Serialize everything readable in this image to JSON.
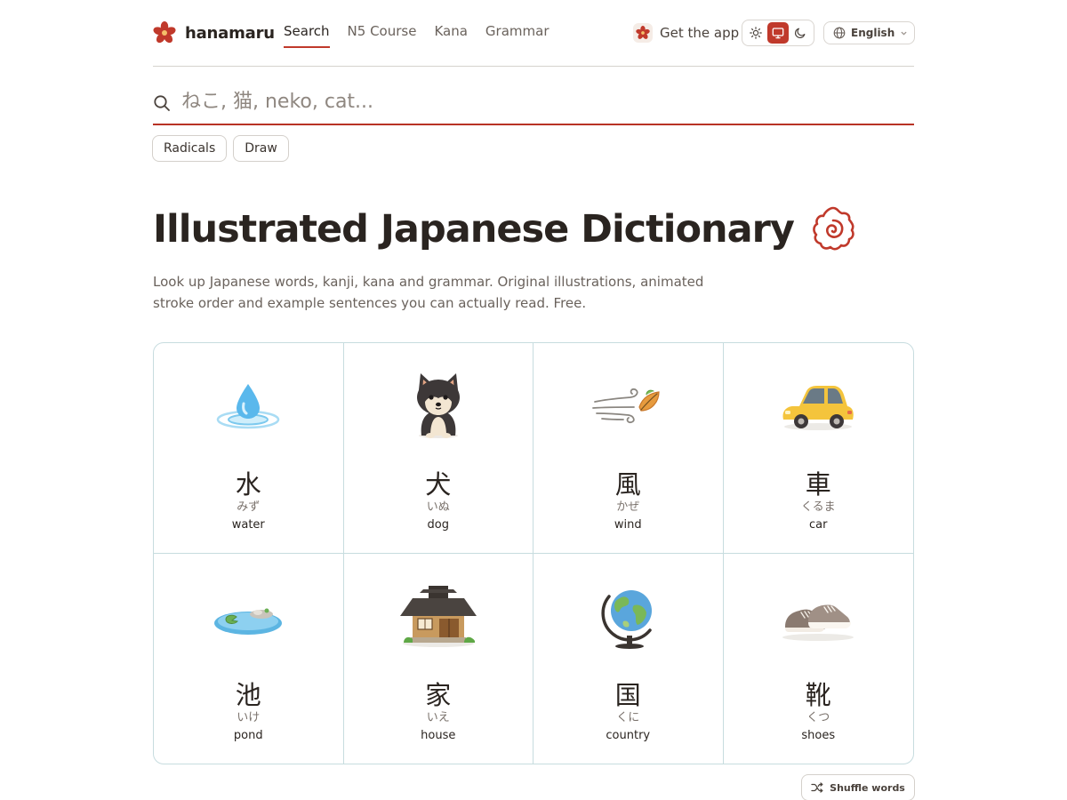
{
  "brand": {
    "name": "hanamaru",
    "logo_icon": "flower-icon",
    "accent": "#c0392b"
  },
  "nav": {
    "items": [
      {
        "label": "Search",
        "active": true
      },
      {
        "label": "N5 Course",
        "active": false
      },
      {
        "label": "Kana",
        "active": false
      },
      {
        "label": "Grammar",
        "active": false
      }
    ]
  },
  "header_actions": {
    "get_app_label": "Get the app",
    "theme_options": [
      "sun-icon",
      "monitor-icon",
      "moon-icon"
    ],
    "theme_selected": "monitor-icon",
    "language_label": "English"
  },
  "search": {
    "placeholder": "ねこ, 猫, neko, cat...",
    "value": "",
    "tools": [
      "Radicals",
      "Draw"
    ]
  },
  "hero": {
    "title": "Illustrated Japanese Dictionary",
    "subtitle": "Look up Japanese words, kanji, kana and grammar. Original illustrations, animated stroke order and example sentences you can actually read. Free."
  },
  "words": [
    {
      "kanji": "水",
      "kana": "みず",
      "gloss": "water",
      "icon": "water-drop-icon"
    },
    {
      "kanji": "犬",
      "kana": "いぬ",
      "gloss": "dog",
      "icon": "shiba-dog-icon"
    },
    {
      "kanji": "風",
      "kana": "かぜ",
      "gloss": "wind",
      "icon": "wind-leaf-icon"
    },
    {
      "kanji": "車",
      "kana": "くるま",
      "gloss": "car",
      "icon": "car-icon"
    },
    {
      "kanji": "池",
      "kana": "いけ",
      "gloss": "pond",
      "icon": "pond-icon"
    },
    {
      "kanji": "家",
      "kana": "いえ",
      "gloss": "house",
      "icon": "house-icon"
    },
    {
      "kanji": "国",
      "kana": "くに",
      "gloss": "country",
      "icon": "globe-icon"
    },
    {
      "kanji": "靴",
      "kana": "くつ",
      "gloss": "shoes",
      "icon": "shoes-icon"
    }
  ],
  "shuffle_label": "Shuffle words"
}
